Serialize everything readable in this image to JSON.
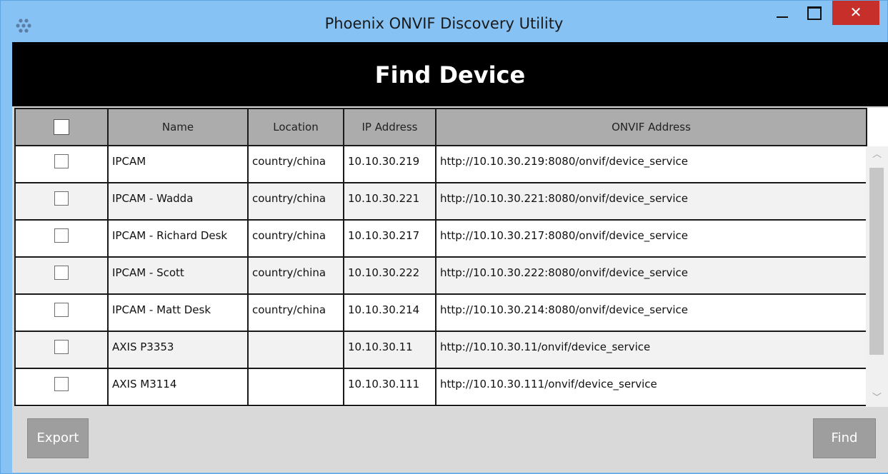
{
  "window": {
    "title": "Phoenix ONVIF Discovery Utility",
    "close_glyph": "✕",
    "icon": "app-dots-icon"
  },
  "header": {
    "title": "Find Device"
  },
  "table": {
    "columns": [
      "Name",
      "Location",
      "IP Address",
      "ONVIF Address"
    ],
    "rows": [
      {
        "name": "IPCAM",
        "location": "country/china",
        "ip": "10.10.30.219",
        "onvif": "http://10.10.30.219:8080/onvif/device_service"
      },
      {
        "name": "IPCAM - Wadda",
        "location": "country/china",
        "ip": "10.10.30.221",
        "onvif": "http://10.10.30.221:8080/onvif/device_service"
      },
      {
        "name": "IPCAM - Richard Desk",
        "location": "country/china",
        "ip": "10.10.30.217",
        "onvif": "http://10.10.30.217:8080/onvif/device_service"
      },
      {
        "name": "IPCAM - Scott",
        "location": "country/china",
        "ip": "10.10.30.222",
        "onvif": "http://10.10.30.222:8080/onvif/device_service"
      },
      {
        "name": "IPCAM - Matt Desk",
        "location": "country/china",
        "ip": "10.10.30.214",
        "onvif": "http://10.10.30.214:8080/onvif/device_service"
      },
      {
        "name": "AXIS P3353",
        "location": "",
        "ip": "10.10.30.11",
        "onvif": "http://10.10.30.11/onvif/device_service"
      },
      {
        "name": "AXIS M3114",
        "location": "",
        "ip": "10.10.30.111",
        "onvif": "http://10.10.30.111/onvif/device_service"
      }
    ]
  },
  "scrollbar": {
    "up_glyph": "︿",
    "down_glyph": "﹀"
  },
  "buttons": {
    "export": "Export",
    "find": "Find"
  },
  "colors": {
    "titlebar": "#86c2f4",
    "close": "#c7302a",
    "header": "#000000",
    "column_header": "#acacac",
    "button": "#9e9e9e"
  }
}
